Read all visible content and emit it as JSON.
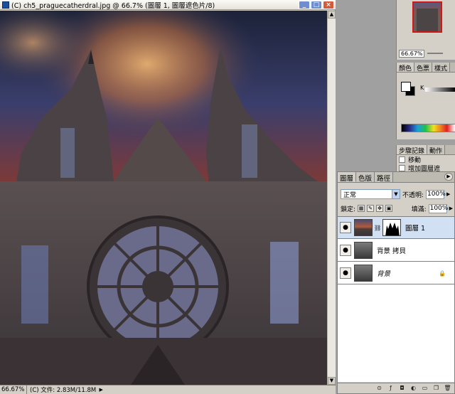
{
  "document": {
    "title": "(C) ch5_praguecatherdral.jpg @ 66.7% (圖層 1, 圖層遮色片/8)",
    "window_buttons": [
      "_",
      "□",
      "×"
    ]
  },
  "statusbar": {
    "zoom": "66.67%",
    "file_info": "(C) 文件: 2.83M/11.8M",
    "arrow": "▶"
  },
  "navigator": {
    "zoom": "66.67%"
  },
  "color_panel": {
    "tabs": [
      "顏色",
      "色票",
      "樣式"
    ],
    "k_label": "K"
  },
  "history_panel": {
    "tabs": [
      "步驟記錄",
      "動作"
    ],
    "items": [
      "移動",
      "增加圖層遮"
    ]
  },
  "layers_panel": {
    "tabs": [
      "圖層",
      "色版",
      "路徑"
    ],
    "blend_mode": "正常",
    "opacity_label": "不透明:",
    "opacity_value": "100%",
    "lock_label": "鎖定:",
    "fill_label": "填滿:",
    "fill_value": "100%",
    "layers": [
      {
        "name": "圖層 1",
        "selected": true,
        "italic": false,
        "locked": false
      },
      {
        "name": "背景 拷貝",
        "selected": false,
        "italic": false,
        "locked": false
      },
      {
        "name": "背景",
        "selected": false,
        "italic": true,
        "locked": true
      }
    ]
  },
  "icons": {
    "eye": "eye-icon",
    "lock": "lock-icon",
    "chain": "chain-link-icon"
  },
  "colors": {
    "selection": "#d2e0f4",
    "panel_bg": "#d4d0c8",
    "nav_frame": "#d01818"
  }
}
